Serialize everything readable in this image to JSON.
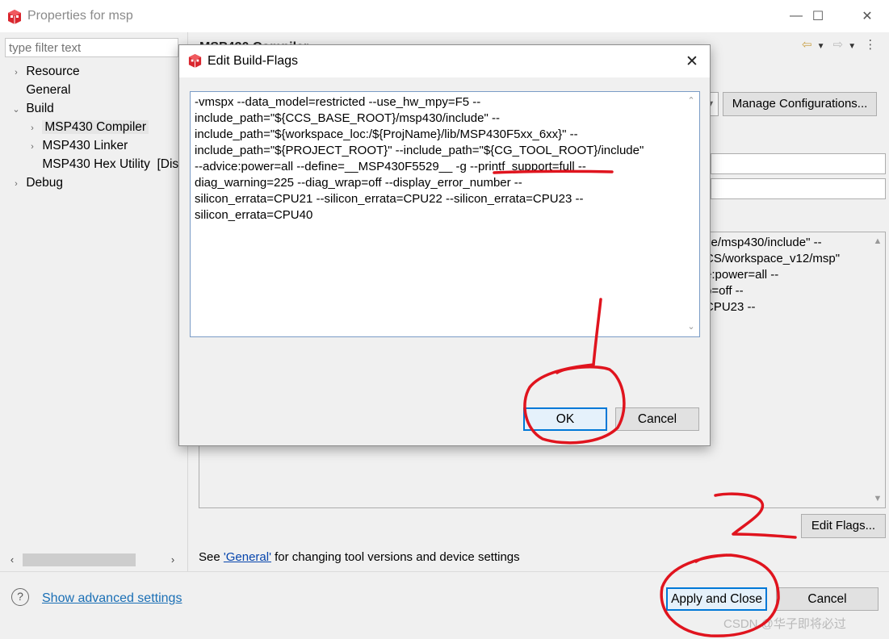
{
  "window": {
    "title": "Properties for msp",
    "minimize_glyph": "—",
    "maximize_glyph": "☐",
    "close_glyph": "✕"
  },
  "filter": {
    "placeholder": "type filter text"
  },
  "tree": {
    "items": [
      {
        "label": "Resource",
        "arrow": "›"
      },
      {
        "label": "General",
        "arrow": ""
      },
      {
        "label": "Build",
        "arrow": "⌄"
      },
      {
        "label": "MSP430 Compiler",
        "arrow": "›"
      },
      {
        "label": "MSP430 Linker",
        "arrow": "›"
      },
      {
        "label": "MSP430 Hex Utility  [Dis",
        "arrow": ""
      },
      {
        "label": "Debug",
        "arrow": "›"
      }
    ]
  },
  "page": {
    "title": "MSP430 Compiler",
    "manage_configurations": "Manage Configurations...",
    "flags_visible_lines": [
      "se/msp430/include\" --",
      "CS/workspace_v12/msp\"",
      "e:power=all --",
      "p=off --",
      "CPU23 --"
    ],
    "edit_flags": "Edit Flags...",
    "footnote_prefix": "See ",
    "footnote_link": "'General'",
    "footnote_suffix": " for changing tool versions and device settings"
  },
  "bottom": {
    "help_glyph": "?",
    "show_advanced": "Show advanced settings",
    "apply_and_close": "Apply and Close",
    "cancel": "Cancel"
  },
  "dialog": {
    "title": "Edit Build-Flags",
    "close_glyph": "✕",
    "flags_text": "-vmspx --data_model=restricted --use_hw_mpy=F5 --\ninclude_path=\"${CCS_BASE_ROOT}/msp430/include\" --\ninclude_path=\"${workspace_loc:/${ProjName}/lib/MSP430F5xx_6xx}\" --\ninclude_path=\"${PROJECT_ROOT}\" --include_path=\"${CG_TOOL_ROOT}/include\"\n--advice:power=all --define=__MSP430F5529__ -g --printf_support=full --\ndiag_warning=225 --diag_wrap=off --display_error_number --\nsilicon_errata=CPU21 --silicon_errata=CPU22 --silicon_errata=CPU23 --\nsilicon_errata=CPU40",
    "ok": "OK",
    "cancel": "Cancel"
  },
  "watermark": "CSDN @华子即将必过",
  "colors": {
    "accent": "#0078d7",
    "link": "#1a6fb5",
    "annotation_red": "#e0141e",
    "app_icon_red": "#d9262e"
  },
  "icons": {
    "app": "ccs-cube-icon",
    "back": "back-arrow-icon",
    "forward": "forward-arrow-icon",
    "menu": "view-menu-icon"
  }
}
